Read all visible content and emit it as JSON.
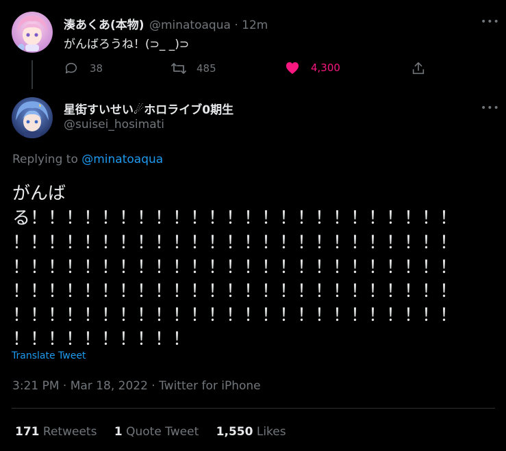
{
  "parent_tweet": {
    "display_name": "湊あくあ(本物)",
    "handle": "@minatoaqua",
    "separator": "·",
    "time_ago": "12m",
    "text": "がんばろうね！(⊃_ _)⊃",
    "more": "•••",
    "replies": "38",
    "retweets": "485",
    "likes": "4,300"
  },
  "main_tweet": {
    "display_name": "星街すいせい☄ホロライブ0期生",
    "handle": "@suisei_hosimati",
    "more": "•••",
    "replying_prefix": "Replying to",
    "replying_handle": "@minatoaqua",
    "text_lines": [
      "がんば",
      "る！！！！！！！！！！！！！！！！！！！！！！！！",
      "！！！！！！！！！！！！！！！！！！！！！！！！！",
      "！！！！！！！！！！！！！！！！！！！！！！！！！",
      "！！！！！！！！！！！！！！！！！！！！！！！！！",
      "！！！！！！！！！！！！！！！！！！！！！！！！！",
      "！！！！！！！！！！"
    ],
    "translate": "Translate Tweet",
    "timestamp": "3:21 PM · Mar 18, 2022 · Twitter for iPhone",
    "stats": {
      "retweets_count": "171",
      "retweets_label": "Retweets",
      "quotes_count": "1",
      "quotes_label": "Quote Tweet",
      "likes_count": "1,550",
      "likes_label": "Likes"
    }
  },
  "colors": {
    "background": "#000000",
    "text": "#e7e9ea",
    "muted": "#71767b",
    "accent": "#1d9bf0",
    "like": "#f91880"
  },
  "icons": {
    "reply": "reply-icon",
    "retweet": "retweet-icon",
    "like": "heart-icon",
    "share": "share-icon",
    "more": "more-icon",
    "comet": "comet-icon"
  }
}
